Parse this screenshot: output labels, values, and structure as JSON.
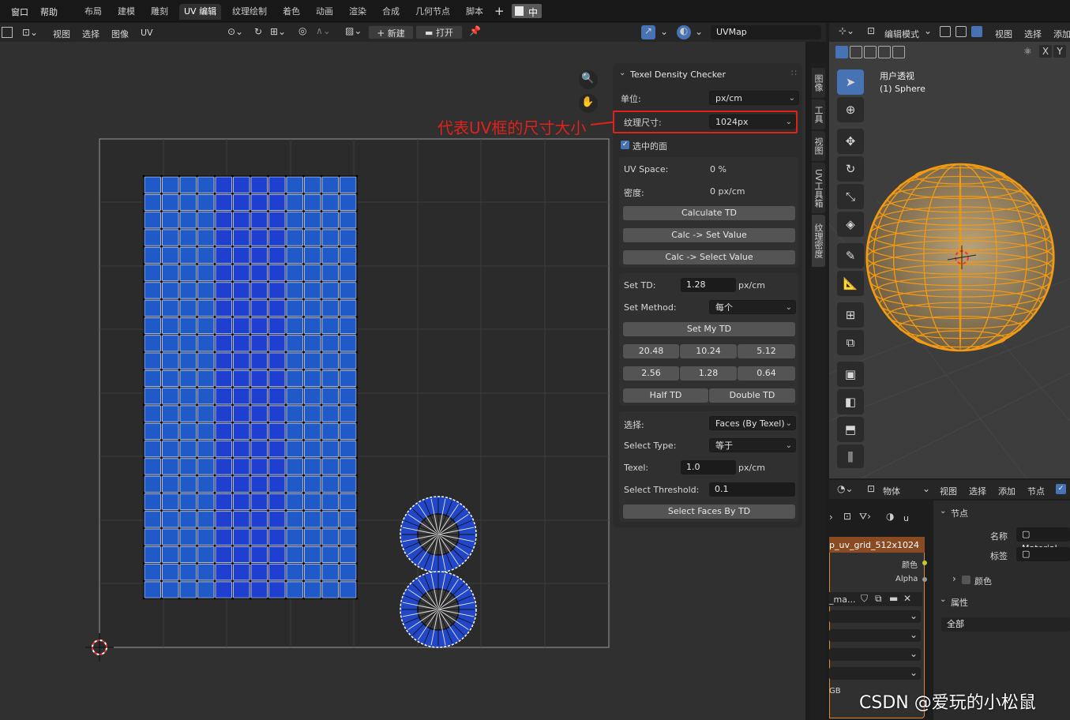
{
  "topbar": {
    "menus": [
      "窗口",
      "帮助"
    ],
    "tabs": [
      "布局",
      "建模",
      "雕刻",
      "UV 编辑",
      "纹理绘制",
      "着色",
      "动画",
      "渲染",
      "合成",
      "几何节点",
      "脚本"
    ],
    "add": "+",
    "ime": "中"
  },
  "uv_header": {
    "menus": [
      "视图",
      "选择",
      "图像",
      "UV"
    ],
    "new_label": "新建",
    "open_label": "打开",
    "uvmap": "UVMap"
  },
  "annotation": {
    "text": "代表UV框的尺寸大小",
    "color": "#e0221b"
  },
  "td_panel": {
    "title": "Texel Density Checker",
    "units_label": "单位:",
    "units_value": "px/cm",
    "texture_size_label": "纹理尺寸:",
    "texture_size_value": "1024px",
    "selected_faces_label": "选中的面",
    "uv_space_label": "UV Space:",
    "uv_space_value": "0 %",
    "density_label": "密度:",
    "density_value": "0 px/cm",
    "calc_td": "Calculate TD",
    "calc_set_value": "Calc -> Set Value",
    "calc_select_value": "Calc -> Select Value",
    "set_td_label": "Set TD:",
    "set_td_value": "1.28",
    "set_td_unit": "px/cm",
    "set_method_label": "Set Method:",
    "set_method_value": "每个",
    "set_my_td": "Set My TD",
    "presets_row1": [
      "20.48",
      "10.24",
      "5.12"
    ],
    "presets_row2": [
      "2.56",
      "1.28",
      "0.64"
    ],
    "half_td": "Half TD",
    "double_td": "Double TD",
    "select_label": "选择:",
    "select_value": "Faces (By Texel)",
    "select_type_label": "Select Type:",
    "select_type_value": "等于",
    "texel_label": "Texel:",
    "texel_value": "1.0",
    "texel_unit": "px/cm",
    "threshold_label": "Select Threshold:",
    "threshold_value": "0.1",
    "select_faces_btn": "Select Faces By TD"
  },
  "side_tabs": [
    "图像",
    "工具",
    "视图",
    "UV工具箱",
    "纹理密度"
  ],
  "viewport3d": {
    "mode": "编辑模式",
    "menus": [
      "视图",
      "选择",
      "添加"
    ],
    "view_name": "用户透视",
    "object_name": "(1) Sphere",
    "axes": [
      "X",
      "Y"
    ]
  },
  "node_editor": {
    "object_mode": "物体",
    "menus": [
      "视图",
      "选择",
      "添加",
      "节点"
    ],
    "node_title": "p_uv_grid_512x1024",
    "socket_color": "颜色",
    "socket_alpha": "Alpha",
    "image_field": "_ma...",
    "colorspace": "GB",
    "breadcrumb_u": "u",
    "props": {
      "node_section": "节点",
      "name_label": "名称",
      "name_value": "Material",
      "label_label": "标签",
      "color_section": "颜色",
      "attr_section": "属性",
      "attr_value": "全部"
    }
  },
  "watermark": "CSDN @爱玩的小松鼠",
  "colors": {
    "accent": "#4772b3",
    "uv_face": "#1f4fd0",
    "mesh_orange": "#f29a12",
    "annotation_red": "#e0221b"
  }
}
